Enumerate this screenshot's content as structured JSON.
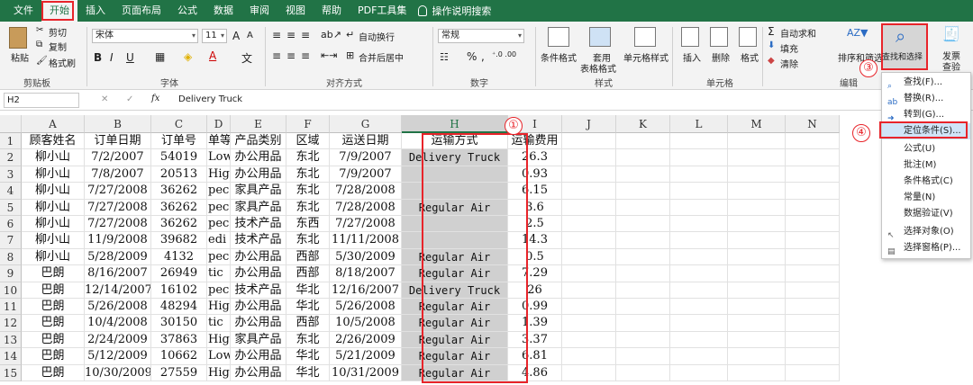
{
  "menu": {
    "tabs": [
      "文件",
      "开始",
      "插入",
      "页面布局",
      "公式",
      "数据",
      "审阅",
      "视图",
      "帮助",
      "PDF工具集"
    ],
    "tell_me": "操作说明搜索"
  },
  "ribbon": {
    "clipboard": {
      "paste": "粘贴",
      "cut": "剪切",
      "copy": "复制",
      "format_painter": "格式刷",
      "label": "剪贴板"
    },
    "font": {
      "family": "宋体",
      "size": "11",
      "bold": "B",
      "italic": "I",
      "underline": "U",
      "grow": "A",
      "shrink": "A",
      "label": "字体"
    },
    "alignment": {
      "wrap": "自动换行",
      "merge": "合并后居中",
      "label": "对齐方式"
    },
    "number": {
      "format": "常规",
      "percent": "%",
      "comma": ",",
      "label": "数字"
    },
    "styles": {
      "conditional": "条件格式",
      "table": "套用",
      "table2": "表格格式",
      "cell_styles": "单元格样式",
      "label": "样式"
    },
    "cells": {
      "insert": "插入",
      "delete": "删除",
      "format": "格式",
      "label": "单元格"
    },
    "editing": {
      "autosum": "自动求和",
      "fill": "填充",
      "clear": "清除",
      "sort": "排序和筛选",
      "find": "查找和选择",
      "label": "编辑"
    },
    "invoice": {
      "line1": "发票",
      "line2": "查验"
    }
  },
  "formula_bar": {
    "name_box": "H2",
    "fx": "fx",
    "content": "Delivery Truck"
  },
  "columns": [
    "A",
    "B",
    "C",
    "D",
    "E",
    "F",
    "G",
    "H",
    "I",
    "J",
    "K",
    "L",
    "M",
    "N"
  ],
  "rows": [
    [
      "1",
      "顾客姓名",
      "订单日期",
      "订单号",
      "单等",
      "产品类别",
      "区域",
      "运送日期",
      "运输方式",
      "运输费用"
    ],
    [
      "2",
      "柳小山",
      "7/2/2007",
      "54019",
      "Low",
      "办公用品",
      "东北",
      "7/9/2007",
      "Delivery Truck",
      "26.3"
    ],
    [
      "3",
      "柳小山",
      "7/8/2007",
      "20513",
      "Higl",
      "办公用品",
      "东北",
      "7/9/2007",
      "",
      "0.93"
    ],
    [
      "4",
      "柳小山",
      "7/27/2008",
      "36262",
      "pec",
      "家具产品",
      "东北",
      "7/28/2008",
      "",
      "6.15"
    ],
    [
      "5",
      "柳小山",
      "7/27/2008",
      "36262",
      "pec",
      "家具产品",
      "东北",
      "7/28/2008",
      "Regular Air",
      "3.6"
    ],
    [
      "6",
      "柳小山",
      "7/27/2008",
      "36262",
      "pec",
      "技术产品",
      "东西",
      "7/27/2008",
      "",
      "2.5"
    ],
    [
      "7",
      "柳小山",
      "11/9/2008",
      "39682",
      "edi",
      "技术产品",
      "东北",
      "11/11/2008",
      "",
      "14.3"
    ],
    [
      "8",
      "柳小山",
      "5/28/2009",
      "4132",
      "pec",
      "办公用品",
      "西部",
      "5/30/2009",
      "Regular Air",
      "0.5"
    ],
    [
      "9",
      "巴朗",
      "8/16/2007",
      "26949",
      "tic",
      "办公用品",
      "西部",
      "8/18/2007",
      "Regular Air",
      "7.29"
    ],
    [
      "10",
      "巴朗",
      "12/14/2007",
      "16102",
      "pec",
      "技术产品",
      "华北",
      "12/16/2007",
      "Delivery Truck",
      "26"
    ],
    [
      "11",
      "巴朗",
      "5/26/2008",
      "48294",
      "Higl",
      "办公用品",
      "华北",
      "5/26/2008",
      "Regular Air",
      "0.99"
    ],
    [
      "12",
      "巴朗",
      "10/4/2008",
      "30150",
      "tic",
      "办公用品",
      "西部",
      "10/5/2008",
      "Regular Air",
      "1.39"
    ],
    [
      "13",
      "巴朗",
      "2/24/2009",
      "37863",
      "Higl",
      "家具产品",
      "东北",
      "2/26/2009",
      "Regular Air",
      "3.37"
    ],
    [
      "14",
      "巴朗",
      "5/12/2009",
      "10662",
      "Low",
      "办公用品",
      "华北",
      "5/21/2009",
      "Regular Air",
      "6.81"
    ],
    [
      "15",
      "巴朗",
      "10/30/2009",
      "27559",
      "Higl",
      "办公用品",
      "华北",
      "10/31/2009",
      "Regular Air",
      "4.86"
    ]
  ],
  "dropdown": {
    "items": [
      "查找(F)...",
      "替换(R)...",
      "转到(G)...",
      "定位条件(S)...",
      "公式(U)",
      "批注(M)",
      "条件格式(C)",
      "常量(N)",
      "数据验证(V)",
      "选择对象(O)",
      "选择窗格(P)..."
    ]
  },
  "callouts": [
    "①",
    "②",
    "③",
    "④"
  ],
  "colors": {
    "accent": "#217346",
    "highlight": "#e8242a",
    "selection": "#d0d0d0"
  }
}
